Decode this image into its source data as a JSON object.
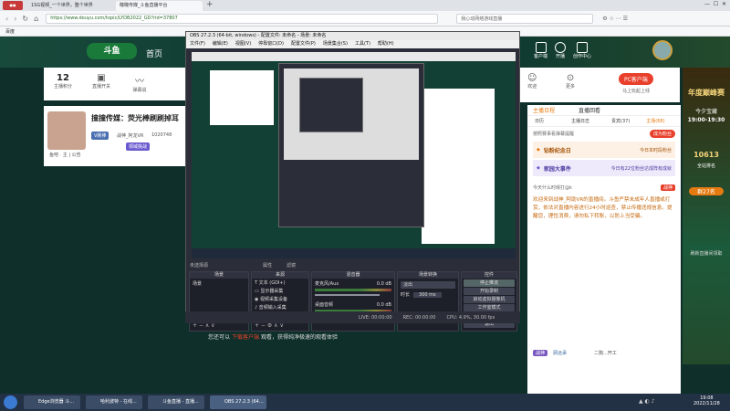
{
  "browser": {
    "tabs": [
      "1SG视频_一个世界，整个世界",
      "瞳瞳传媒_斗鱼直播平台",
      "直播间_斗鱼直播平台"
    ],
    "url": "https://www.douyu.com/topic/LYDB2022_GD?rid=37807",
    "bookmark": "百度",
    "addr_right": "我心动网络游戏直播"
  },
  "site": {
    "nav_home": "首页",
    "stats": [
      {
        "value": "12",
        "label": "主播积分"
      },
      {
        "value": "",
        "label": "直播开关"
      },
      {
        "value": "",
        "label": "弹幕说"
      }
    ],
    "right_icons": [
      "客户端",
      "开播",
      "创作中心"
    ],
    "user_icons": [
      "欢迎",
      "更多"
    ],
    "pc_client": "PC客户端",
    "pc_client_sub": "马上玩起上线",
    "streamer_title": "撞撞传媒：荧光棒刷刷掉耳",
    "streamer_sub": "鱼吧 · 主 | 公告",
    "v_badge": "V刷棒",
    "owner": "战神_阿龙VR",
    "hot": "1020748",
    "tags": [
      "领域挑战"
    ],
    "bottom_text_1": "您还可以",
    "bottom_link": "下载客户端",
    "bottom_text_2": "观看，获得纯净极速的观看体验"
  },
  "chat": {
    "tabs": [
      "主播日程",
      "直播回看"
    ],
    "sub_tabs": [
      "日历",
      "主播日志",
      "贵宾(37)",
      "主场(68)"
    ],
    "active_subtab": "主场(68)",
    "notice": "按照赛事看弹幕提醒",
    "join_btn": "成为粉丝",
    "events": [
      {
        "title": "钻粉纪念日",
        "note": "今日本时段粉丝"
      },
      {
        "title": "家园大事件",
        "note": "今日有22位粉丝达成阵有成就"
      }
    ],
    "msg_pin": "今天什么时候打@k",
    "msg_badge": "战神",
    "system_msg": "欢迎来到战神_阿助VR的直播间。斗鱼严禁未成年人直播或打赏，依法对直播内容进行24小时巡查，禁止传播违规信息。提醒您，理性消费，请勿私下转账，以防上当受骗。",
    "user_line": "战神",
    "user_name": "顾远承",
    "foot": "二狗...开工"
  },
  "promo": {
    "title": "年度巅峰赛",
    "sub": "今夕宝藏",
    "time": "19:00-19:30",
    "number": "10613",
    "label": "全站排名",
    "rank": "群27名",
    "bottom": "刷新直播间领取"
  },
  "obs": {
    "title": "OBS 27.2.3 (64-bit, windows) - 配置文件: 未命名 - 场景: 未命名",
    "menu": [
      "文件(F)",
      "编辑(E)",
      "视图(V)",
      "停靠窗口(D)",
      "配置文件(P)",
      "场景集合(S)",
      "工具(T)",
      "帮助(H)"
    ],
    "no_source": "未选择源",
    "attr_btn": "属性",
    "filter_btn": "滤镜",
    "docks": [
      "场景",
      "来源",
      "混音器",
      "场景转换",
      "控件"
    ],
    "scene": "场景",
    "sources": [
      "文本 (GDI+)",
      "显示器采集",
      "视频采集设备",
      "音频输入采集"
    ],
    "mixer": [
      {
        "name": "麦克风/Aux",
        "db": "0.0 dB"
      },
      {
        "name": "桌面音频",
        "db": "0.0 dB"
      }
    ],
    "transition": "淡出",
    "duration_label": "时长",
    "duration": "300 ms",
    "controls": [
      "停止推流",
      "开始录制",
      "启动虚拟摄像机",
      "工作室模式",
      "设置",
      "退出"
    ],
    "status": {
      "live": "LIVE: 00:00:00",
      "rec": "REC: 00:00:00",
      "cpu": "CPU: 4.9%, 30.00 fps"
    }
  },
  "taskbar": {
    "items": [
      "Edge浏览器 斗鱼直播...",
      "哈利波特 - 在线...",
      "斗鱼直播 - 直播...",
      "OBS 27.2.3 (64-bit..."
    ],
    "clock_time": "19:08",
    "clock_date": "2022/11/28"
  }
}
